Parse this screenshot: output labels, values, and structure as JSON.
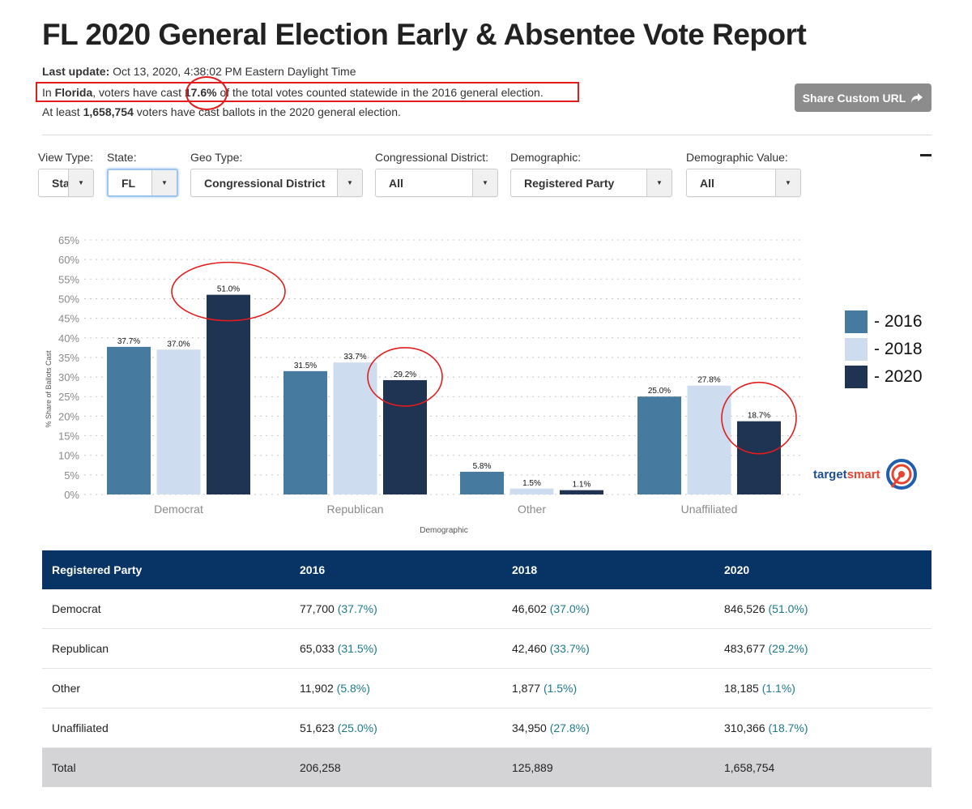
{
  "page": {
    "title": "FL 2020 General Election Early & Absentee Vote Report",
    "last_update_label": "Last update:",
    "last_update_value": "Oct 13, 2020, 4:38:02 PM Eastern Daylight Time",
    "line2_pre": "In ",
    "line2_state": "Florida",
    "line2_mid": ", voters have cast ",
    "line2_pct": "17.6%",
    "line2_post": " of the total votes counted statewide in the 2016 general election.",
    "line3_pre": "At least ",
    "line3_count": "1,658,754",
    "line3_post": " voters have cast ballots in the 2020 general election.",
    "share_button": "Share Custom URL",
    "share_icon": "share-arrow-icon",
    "collapse_icon": "minus-icon"
  },
  "filters": [
    {
      "label": "View Type:",
      "value": "Sta"
    },
    {
      "label": "State:",
      "value": "FL"
    },
    {
      "label": "Geo Type:",
      "value": "Congressional District"
    },
    {
      "label": "Congressional District:",
      "value": "All"
    },
    {
      "label": "Demographic:",
      "value": "Registered Party"
    },
    {
      "label": "Demographic Value:",
      "value": "All"
    }
  ],
  "colors": {
    "s2016": "#467a9e",
    "s2018": "#cddcee",
    "s2020": "#1f3352",
    "annotation": "#e21d1d",
    "table_header": "#073465",
    "pct_text": "#1d7a8a"
  },
  "chart_data": {
    "type": "bar",
    "title": "",
    "xlabel": "Demographic",
    "ylabel": "% Share of Ballots Cast",
    "ylim": [
      0,
      65
    ],
    "yticks": [
      "0%",
      "5%",
      "10%",
      "15%",
      "20%",
      "25%",
      "30%",
      "35%",
      "40%",
      "45%",
      "50%",
      "55%",
      "60%",
      "65%"
    ],
    "grid": true,
    "legend_position": "right",
    "categories": [
      "Democrat",
      "Republican",
      "Other",
      "Unaffiliated"
    ],
    "series": [
      {
        "name": "2016",
        "legend": "- 2016",
        "values": [
          37.7,
          31.5,
          5.8,
          25.0
        ],
        "labels": [
          "37.7%",
          "31.5%",
          "5.8%",
          "25.0%"
        ]
      },
      {
        "name": "2018",
        "legend": "- 2018",
        "values": [
          37.0,
          33.7,
          1.5,
          27.8
        ],
        "labels": [
          "37.0%",
          "33.7%",
          "1.5%",
          "27.8%"
        ]
      },
      {
        "name": "2020",
        "legend": "- 2020",
        "values": [
          51.0,
          29.2,
          1.1,
          18.7
        ],
        "labels": [
          "51.0%",
          "29.2%",
          "1.1%",
          "18.7%"
        ]
      }
    ],
    "annotations": [
      "circle around Democrat 2020 (51.0%)",
      "circle around Republican 2020 (29.2%)",
      "circle around Unaffiliated 2020 (18.7%)"
    ]
  },
  "brand": {
    "part1": "target",
    "part2": "smart",
    "icon": "target-bullseye-icon"
  },
  "table": {
    "headers": [
      "Registered Party",
      "2016",
      "2018",
      "2020"
    ],
    "rows": [
      {
        "party": "Democrat",
        "cells": [
          {
            "n": "77,700",
            "p": "(37.7%)"
          },
          {
            "n": "46,602",
            "p": "(37.0%)"
          },
          {
            "n": "846,526",
            "p": "(51.0%)"
          }
        ]
      },
      {
        "party": "Republican",
        "cells": [
          {
            "n": "65,033",
            "p": "(31.5%)"
          },
          {
            "n": "42,460",
            "p": "(33.7%)"
          },
          {
            "n": "483,677",
            "p": "(29.2%)"
          }
        ]
      },
      {
        "party": "Other",
        "cells": [
          {
            "n": "11,902",
            "p": "(5.8%)"
          },
          {
            "n": "1,877",
            "p": "(1.5%)"
          },
          {
            "n": "18,185",
            "p": "(1.1%)"
          }
        ]
      },
      {
        "party": "Unaffiliated",
        "cells": [
          {
            "n": "51,623",
            "p": "(25.0%)"
          },
          {
            "n": "34,950",
            "p": "(27.8%)"
          },
          {
            "n": "310,366",
            "p": "(18.7%)"
          }
        ]
      }
    ],
    "total": {
      "label": "Total",
      "values": [
        "206,258",
        "125,889",
        "1,658,754"
      ]
    }
  }
}
